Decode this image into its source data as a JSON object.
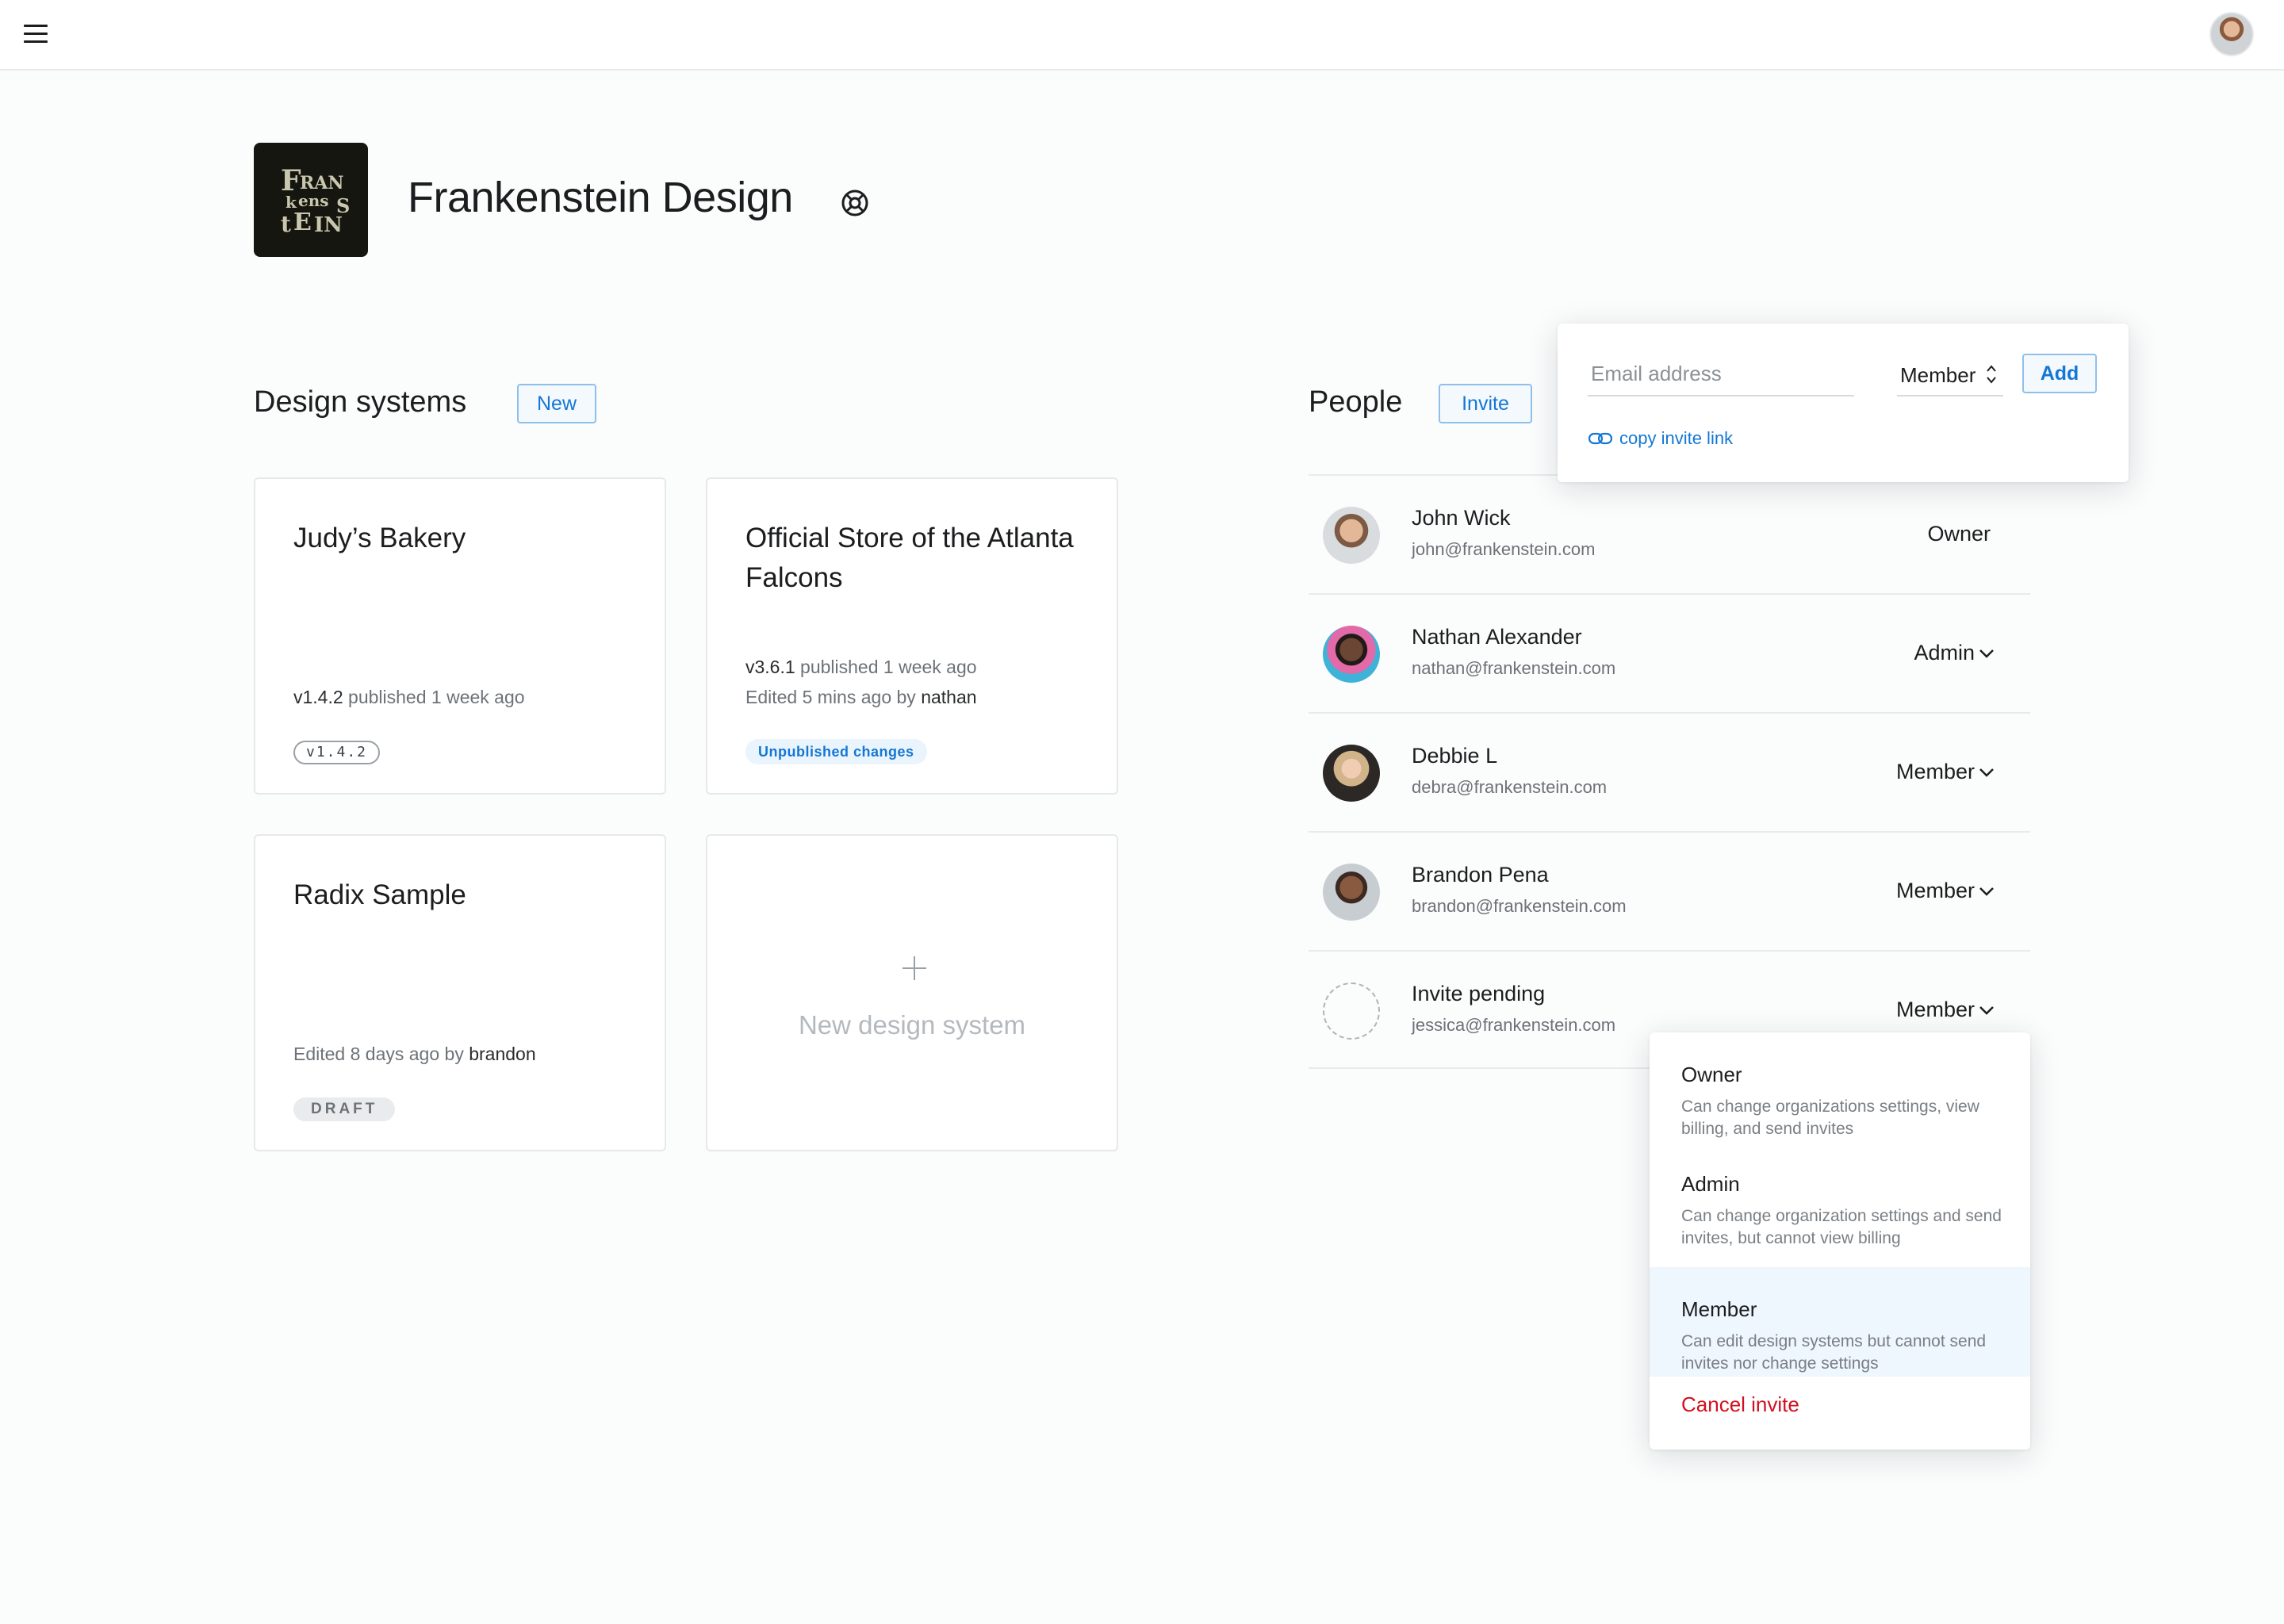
{
  "topbar": {
    "menu_icon": "hamburger-menu-icon",
    "avatar_icon": "user-avatar"
  },
  "org": {
    "name": "Frankenstein Design",
    "logo_text": "FRANKENSTEIN",
    "help_icon": "lifebuoy-icon"
  },
  "design_systems": {
    "title": "Design systems",
    "new_button": "New",
    "cards": [
      {
        "title": "Judy’s Bakery",
        "version": "v1.4.2",
        "published_suffix": "published 1 week ago",
        "tag": "v1.4.2"
      },
      {
        "title": "Official Store of the Atlanta Falcons",
        "version": "v3.6.1",
        "published_suffix": "published 1 week ago",
        "edited_prefix": "Edited 5 mins ago by",
        "edited_by": "nathan",
        "tag": "Unpublished changes"
      },
      {
        "title": "Radix Sample",
        "edited_prefix": "Edited 8 days ago by",
        "edited_by": "brandon",
        "tag": "DRAFT"
      }
    ],
    "new_card_label": "New design system",
    "plus_icon": "plus-icon"
  },
  "people": {
    "title": "People",
    "invite_button": "Invite",
    "rows": [
      {
        "name": "John Wick",
        "email": "john@frankenstein.com",
        "role": "Owner",
        "avatar_color": "#c89a7c"
      },
      {
        "name": "Nathan Alexander",
        "email": "nathan@frankenstein.com",
        "role": "Admin",
        "avatar_color": "#6b4a8c"
      },
      {
        "name": "Debbie L",
        "email": "debra@frankenstein.com",
        "role": "Member",
        "avatar_color": "#b68a5c"
      },
      {
        "name": "Brandon Pena",
        "email": "brandon@frankenstein.com",
        "role": "Member",
        "avatar_color": "#7a5340"
      },
      {
        "name": "Invite pending",
        "email": "jessica@frankenstein.com",
        "role": "Member",
        "avatar_color": ""
      }
    ],
    "chevron_icon": "chevron-down-icon"
  },
  "invite_popover": {
    "email_placeholder": "Email address",
    "role_value": "Member",
    "role_icon": "up-down-chevron-icon",
    "add_button": "Add",
    "copy_link_label": "copy invite link",
    "link_icon": "link-icon"
  },
  "role_dropdown": {
    "items": [
      {
        "title": "Owner",
        "desc": "Can change organizations settings, view billing, and send invites",
        "selected": false
      },
      {
        "title": "Admin",
        "desc": "Can change organization settings and send invites, but cannot view billing",
        "selected": false
      },
      {
        "title": "Member",
        "desc": "Can edit design systems but cannot send invites nor change settings",
        "selected": true
      }
    ],
    "cancel_label": "Cancel invite"
  },
  "colors": {
    "accent": "#1477d4",
    "danger": "#d20f1f",
    "logo_bg": "#15160f",
    "logo_fg": "#c9c7ae"
  }
}
